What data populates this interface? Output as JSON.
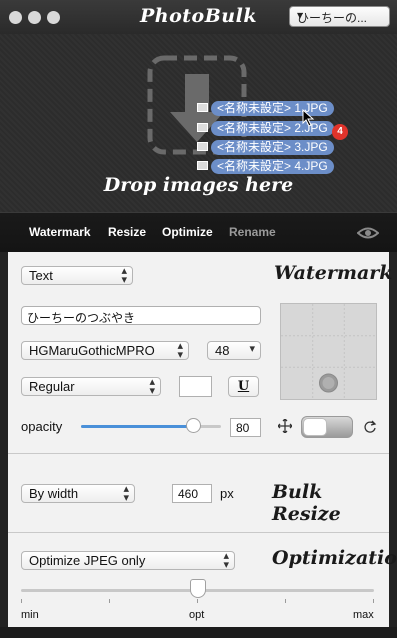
{
  "app": {
    "title": "PhotoBulk",
    "preset_value": "ひーちーの..."
  },
  "drop_zone": {
    "hint": "Drop images here",
    "files": [
      "<名称未設定> 1.JPG",
      "<名称未設定> 2.JPG",
      "<名称未設定> 3.JPG",
      "<名称未設定> 4.JPG"
    ],
    "badge_count": "4"
  },
  "tabs": [
    {
      "label": "Watermark"
    },
    {
      "label": "Resize"
    },
    {
      "label": "Optimize"
    },
    {
      "label": "Rename"
    }
  ],
  "watermark": {
    "title": "Watermark",
    "type_value": "Text",
    "text_value": "ひーちーのつぶやき",
    "font_value": "HGMaruGothicMPRO",
    "size_value": "48",
    "style_value": "Regular",
    "underline_label": "U",
    "opacity_label": "opacity",
    "opacity_value": "80",
    "opacity_fraction": 0.8
  },
  "resize": {
    "title": "Bulk Resize",
    "mode_value": "By width",
    "width_value": "460",
    "unit": "px"
  },
  "optimize": {
    "title": "Optimization",
    "mode_value": "Optimize JPEG only",
    "min_label": "min",
    "opt_label": "opt",
    "max_label": "max",
    "level_fraction": 0.5
  },
  "colors": {
    "accent": "#4a90d9",
    "file_pill": "#6c8ec8",
    "badge": "#e0332b"
  }
}
